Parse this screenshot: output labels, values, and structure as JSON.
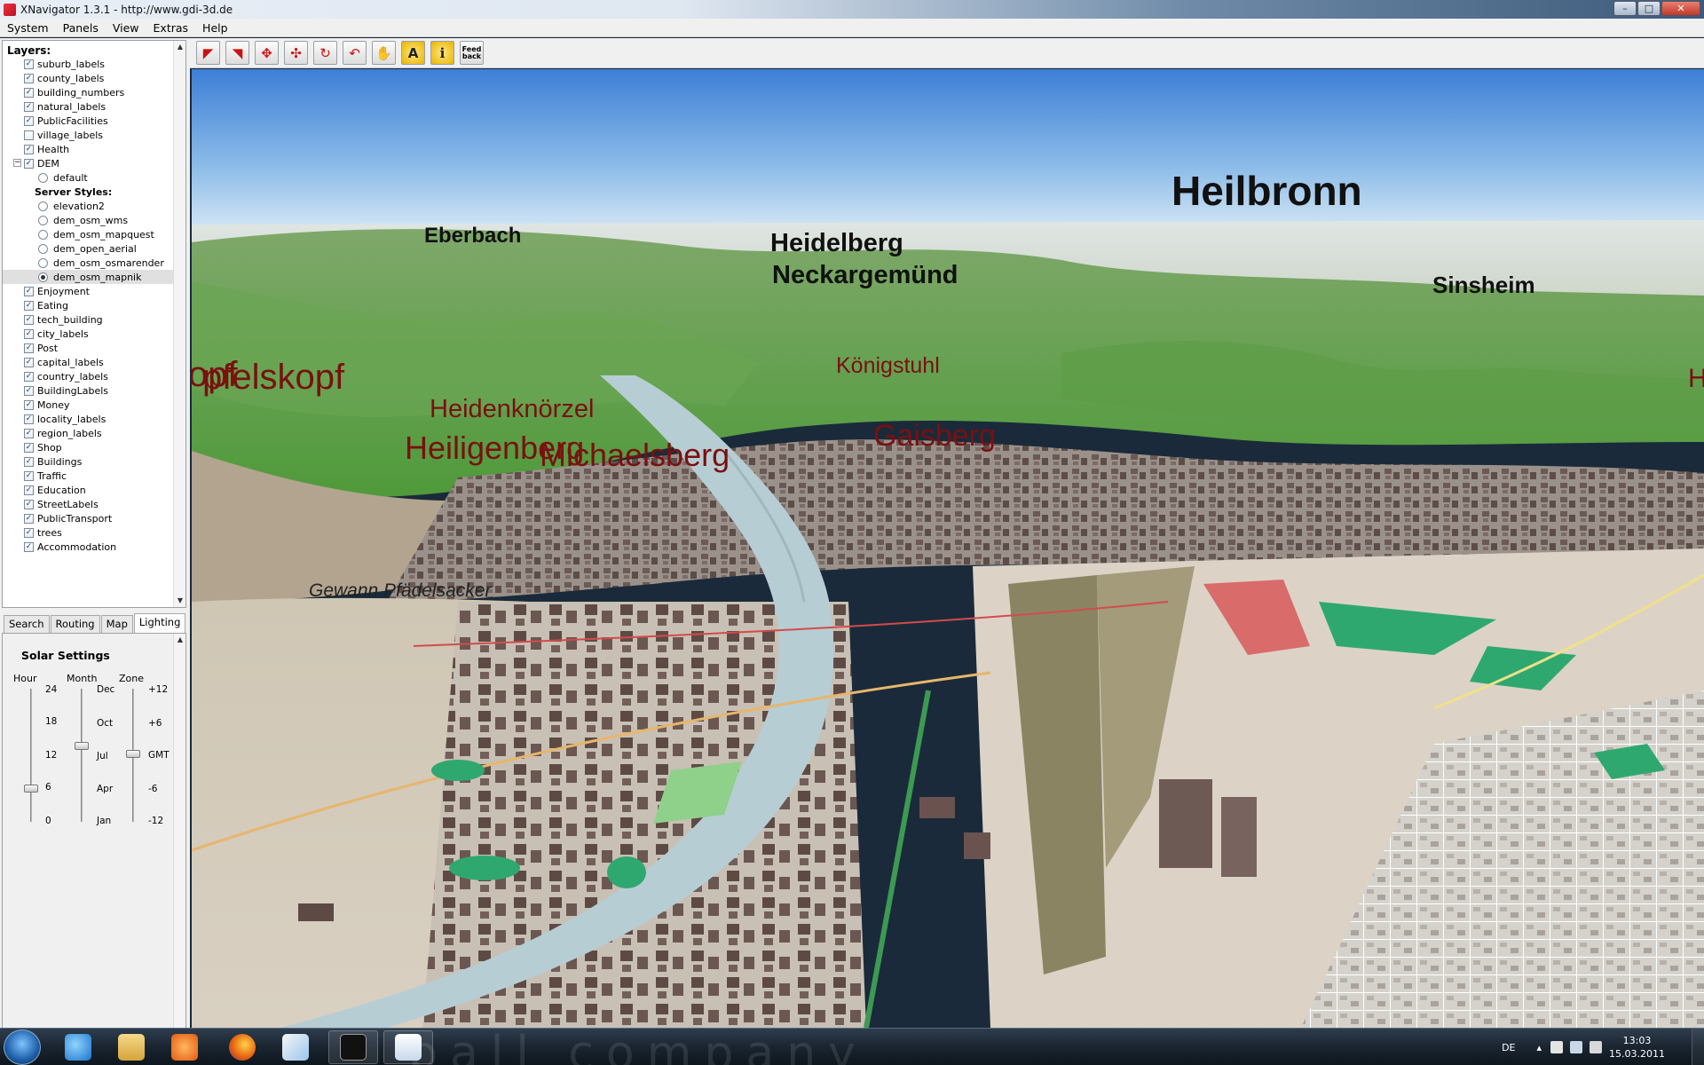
{
  "window": {
    "title": "XNavigator 1.3.1 - http://www.gdi-3d.de"
  },
  "menu": [
    "System",
    "Panels",
    "View",
    "Extras",
    "Help"
  ],
  "layers": {
    "header": "Layers:",
    "items": [
      {
        "label": "suburb_labels",
        "checked": true
      },
      {
        "label": "county_labels",
        "checked": true
      },
      {
        "label": "building_numbers",
        "checked": true
      },
      {
        "label": "natural_labels",
        "checked": true
      },
      {
        "label": "PublicFacilities",
        "checked": true
      },
      {
        "label": "village_labels",
        "checked": false
      },
      {
        "label": "Health",
        "checked": true
      },
      {
        "label": "DEM",
        "checked": true
      },
      {
        "label": "Enjoyment",
        "checked": true
      },
      {
        "label": "Eating",
        "checked": true
      },
      {
        "label": "tech_building",
        "checked": true
      },
      {
        "label": "city_labels",
        "checked": true
      },
      {
        "label": "Post",
        "checked": true
      },
      {
        "label": "capital_labels",
        "checked": true
      },
      {
        "label": "country_labels",
        "checked": true
      },
      {
        "label": "BuildingLabels",
        "checked": true
      },
      {
        "label": "Money",
        "checked": true
      },
      {
        "label": "locality_labels",
        "checked": true
      },
      {
        "label": "region_labels",
        "checked": true
      },
      {
        "label": "Shop",
        "checked": true
      },
      {
        "label": "Buildings",
        "checked": true
      },
      {
        "label": "Traffic",
        "checked": true
      },
      {
        "label": "Education",
        "checked": true
      },
      {
        "label": "StreetLabels",
        "checked": true
      },
      {
        "label": "PublicTransport",
        "checked": true
      },
      {
        "label": "trees",
        "checked": true
      },
      {
        "label": "Accommodation",
        "checked": true
      }
    ],
    "dem_styles": {
      "default": "default",
      "server_header": "Server Styles:",
      "server": [
        "elevation2",
        "dem_osm_wms",
        "dem_osm_mapquest",
        "dem_open_aerial",
        "dem_osm_osmarender",
        "dem_osm_mapnik"
      ],
      "selected": "dem_osm_mapnik"
    }
  },
  "tabs": [
    "Search",
    "Routing",
    "Map",
    "Lighting"
  ],
  "active_tab": "Lighting",
  "solar": {
    "title": "Solar Settings",
    "hour": {
      "label": "Hour",
      "ticks": [
        "24",
        "18",
        "12",
        "6",
        "0"
      ],
      "value": 6
    },
    "month": {
      "label": "Month",
      "ticks": [
        "Dec",
        "Oct",
        "Jul",
        "Apr",
        "Jan"
      ],
      "value": "Jul"
    },
    "zone": {
      "label": "Zone",
      "ticks": [
        "+12",
        "+6",
        "GMT",
        "-6",
        "-12"
      ],
      "value": "GMT"
    }
  },
  "toolbar": {
    "buttons": [
      {
        "name": "fly-icon",
        "glyph": "◤"
      },
      {
        "name": "walk-icon",
        "glyph": "◥"
      },
      {
        "name": "move-icon",
        "glyph": "✥"
      },
      {
        "name": "pan-icon",
        "glyph": "✣"
      },
      {
        "name": "rotate-icon",
        "glyph": "↻"
      },
      {
        "name": "back-icon",
        "glyph": "↶"
      },
      {
        "name": "hand-icon",
        "glyph": "✋"
      },
      {
        "name": "label-icon",
        "glyph": "A"
      },
      {
        "name": "info-icon",
        "glyph": "i"
      }
    ],
    "feedback_line1": "Feed",
    "feedback_line2": "back"
  },
  "map_labels": {
    "cities": [
      "Heilbronn",
      "Eberbach",
      "Heidelberg",
      "Neckargemünd",
      "Sinsheim"
    ],
    "peaks": [
      "Königstuhl",
      "pfelskopf",
      "Heidenknörzel",
      "Heiligenberg",
      "Michaelsberg",
      "Gaisberg"
    ],
    "fragments": [
      "opf",
      "H"
    ],
    "locality": "Gewann Pfädelsacker"
  },
  "taskbar": {
    "lang": "DE",
    "time": "13:03",
    "date": "15.03.2011",
    "watermark": "ball company"
  },
  "colors": {
    "accent": "#c11111",
    "peak_label": "#7a1010",
    "sky_top": "#4a86d8",
    "sky_bottom": "#dcecf8"
  }
}
